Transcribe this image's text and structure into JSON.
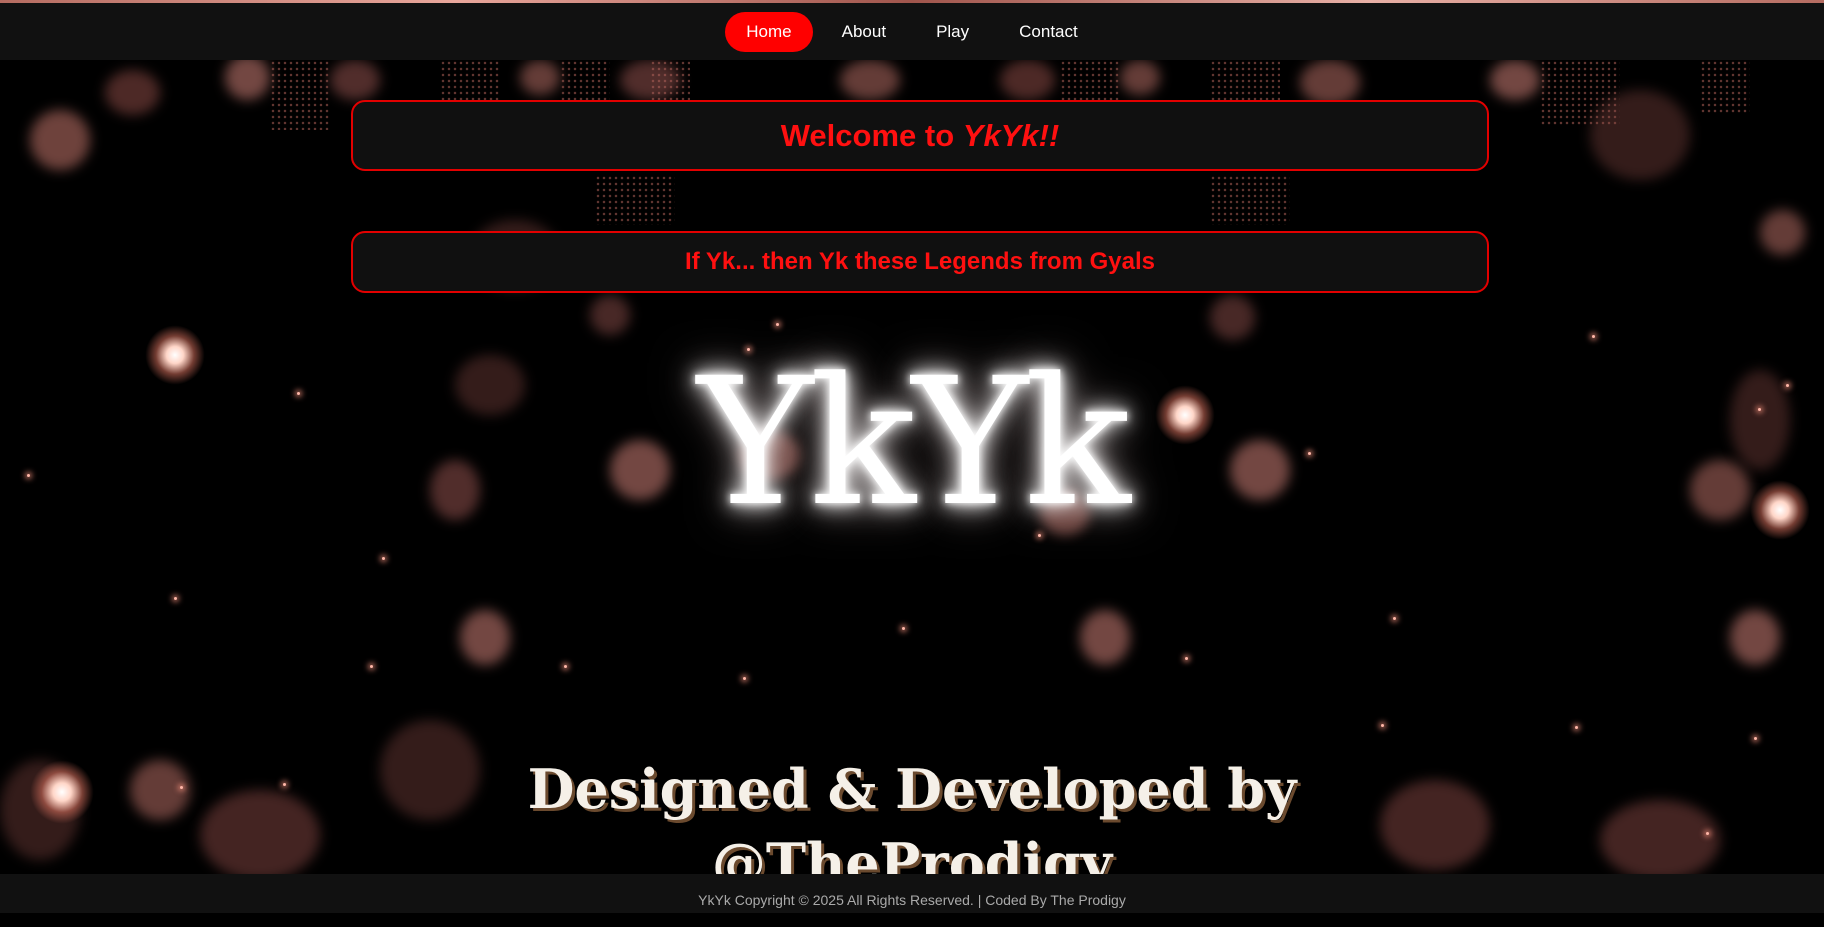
{
  "nav": {
    "items": [
      {
        "label": "Home",
        "active": true
      },
      {
        "label": "About",
        "active": false
      },
      {
        "label": "Play",
        "active": false
      },
      {
        "label": "Contact",
        "active": false
      }
    ]
  },
  "welcome": {
    "prefix": "Welcome to ",
    "highlight": "YkYk!!"
  },
  "tagline": "If Yk... then Yk these Legends from Gyals",
  "logo_text": "YkYk",
  "credit": {
    "line1": "Designed & Developed by",
    "line2": "@TheProdigy"
  },
  "footer": {
    "text": "YkYk Copyright © 2025 All Rights Reserved. | Coded By The Prodigy"
  },
  "colors": {
    "accent": "#ff0000",
    "nav_bg": "#111111",
    "page_bg": "#000000",
    "footer_text": "#aaaaaa"
  }
}
